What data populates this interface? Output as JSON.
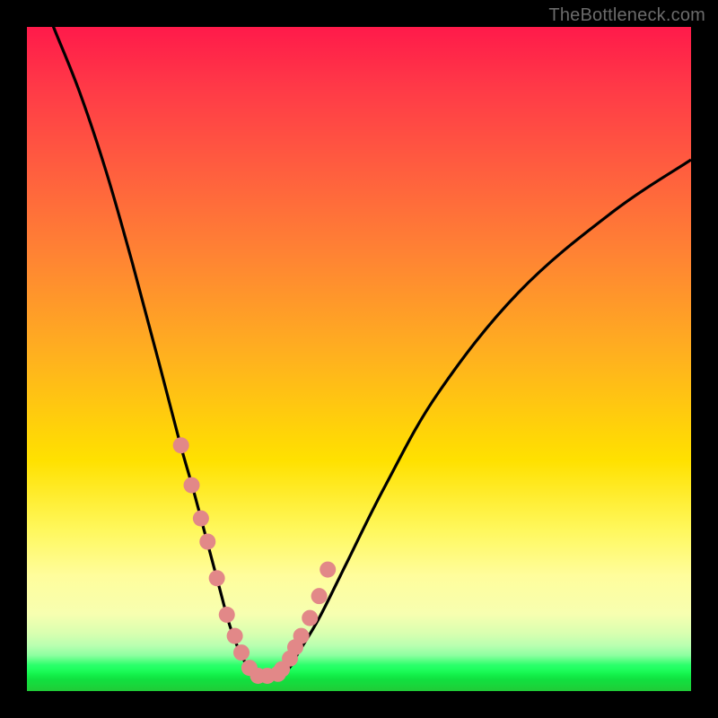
{
  "watermark": {
    "text": "TheBottleneck.com"
  },
  "colors": {
    "background": "#000000",
    "curve_stroke": "#000000",
    "dot_fill": "#e28888",
    "gradient_top": "#ff1a4a",
    "gradient_bottom": "#1fca37"
  },
  "chart_data": {
    "type": "line",
    "title": "",
    "xlabel": "",
    "ylabel": "",
    "xlim": [
      0,
      100
    ],
    "ylim": [
      0,
      100
    ],
    "grid": false,
    "legend": false,
    "annotations": [],
    "series": [
      {
        "name": "bottleneck-curve",
        "type": "line",
        "x": [
          0,
          4,
          8,
          12,
          16,
          20,
          23,
          25,
          27,
          29,
          30.5,
          32,
          33.5,
          34.5,
          35.2,
          37.5,
          39.5,
          41,
          44,
          48,
          54,
          62,
          74,
          88,
          100
        ],
        "y": [
          110,
          100,
          90,
          78,
          64,
          49,
          37.5,
          30.5,
          23,
          15.5,
          10,
          6,
          3.3,
          2.3,
          2.2,
          2.3,
          3.5,
          6,
          11,
          19,
          31,
          45,
          60,
          72,
          80
        ]
      },
      {
        "name": "sample-dots",
        "type": "scatter",
        "x": [
          23.2,
          24.8,
          26.2,
          27.2,
          28.6,
          30.1,
          31.3,
          32.3,
          33.5,
          34.8,
          36.2,
          37.8,
          38.4,
          39.6,
          40.4,
          41.3,
          42.6,
          44.0,
          45.3
        ],
        "y": [
          37.0,
          31.0,
          26.0,
          22.5,
          17.0,
          11.5,
          8.3,
          5.8,
          3.5,
          2.3,
          2.3,
          2.6,
          3.3,
          4.9,
          6.6,
          8.3,
          11.0,
          14.3,
          18.3
        ]
      }
    ],
    "valley_x": 35.5
  }
}
